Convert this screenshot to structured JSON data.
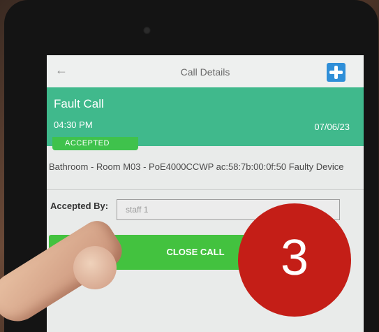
{
  "appbar": {
    "title": "Call Details",
    "back_icon": "arrow-left-icon",
    "logo_icon": "medical-cross-logo-icon"
  },
  "call": {
    "type": "Fault Call",
    "time": "04:30 PM",
    "date": "07/06/23",
    "status": "ACCEPTED",
    "description": "Bathroom - Room M03 - PoE4000CCWP ac:58:7b:00:0f:50 Faulty Device"
  },
  "accepted_by": {
    "label": "Accepted By:",
    "value": "staff 1"
  },
  "actions": {
    "close_label": "CLOSE CALL"
  },
  "step_marker": {
    "number": "3"
  },
  "colors": {
    "header_green": "#40b98c",
    "badge_green": "#3fc24c",
    "button_green": "#43c23f",
    "marker_red": "#c41e17",
    "logo_blue": "#2f8fd8"
  }
}
